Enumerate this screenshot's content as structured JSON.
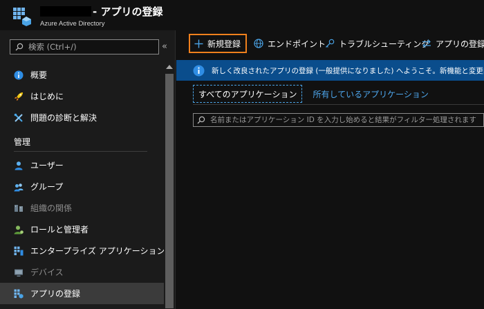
{
  "header": {
    "title": "- アプリの登録",
    "subtitle": "Azure Active Directory"
  },
  "sidebar": {
    "search_placeholder": "検索 (Ctrl+/)",
    "collapse_glyph": "«",
    "items_top": [
      {
        "label": "概要",
        "icon": "info-icon"
      },
      {
        "label": "はじめに",
        "icon": "rocket-icon"
      },
      {
        "label": "問題の診断と解決",
        "icon": "wrench-icon"
      }
    ],
    "section_manage": "管理",
    "items_manage": [
      {
        "label": "ユーザー",
        "icon": "user-icon",
        "disabled": false
      },
      {
        "label": "グループ",
        "icon": "group-icon",
        "disabled": false
      },
      {
        "label": "組織の関係",
        "icon": "org-relationship-icon",
        "disabled": true
      },
      {
        "label": "ロールと管理者",
        "icon": "admin-role-icon",
        "disabled": false
      },
      {
        "label": "エンタープライズ アプリケーション",
        "icon": "enterprise-apps-icon",
        "disabled": false
      },
      {
        "label": "デバイス",
        "icon": "device-icon",
        "disabled": true
      },
      {
        "label": "アプリの登録",
        "icon": "app-registration-icon",
        "disabled": false,
        "selected": true
      }
    ]
  },
  "toolbar": {
    "new_registration": "新規登録",
    "endpoints": "エンドポイント",
    "troubleshooting": "トラブルシューティング",
    "app_registration": "アプリの登録"
  },
  "banner": {
    "text": "新しく改良されたアプリの登録 (一般提供になりました) へようこそ。新機能と変更内容"
  },
  "tabs": {
    "all": "すべてのアプリケーション",
    "owned": "所有しているアプリケーション"
  },
  "filter": {
    "placeholder": "名前またはアプリケーション ID を入力し始めると結果がフィルター処理されます"
  },
  "colors": {
    "accent": "#0078d4",
    "highlight_border": "#f0801c",
    "banner_bg": "#0a4d8c",
    "link": "#4ea8ef"
  }
}
